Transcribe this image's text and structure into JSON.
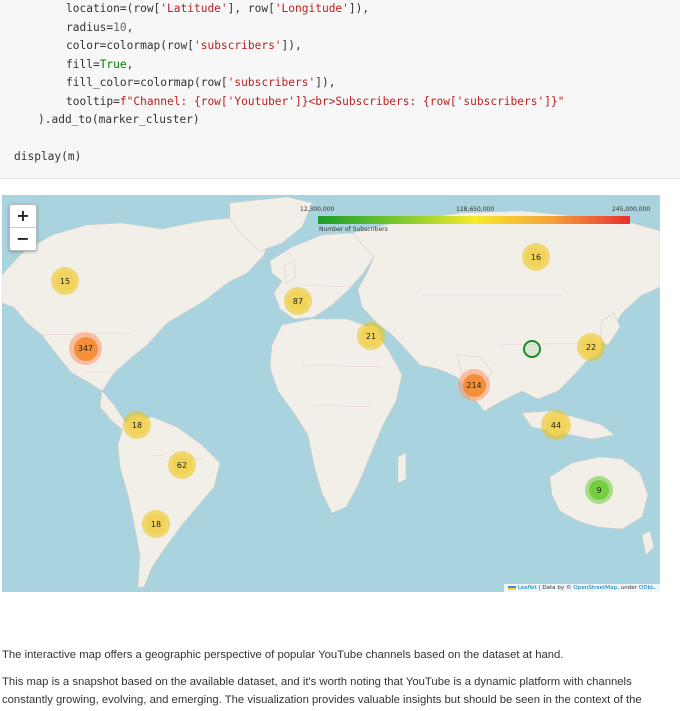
{
  "code": {
    "line1_prefix": "location=(row[",
    "line1_s1": "'Latitude'",
    "line1_mid": "], row[",
    "line1_s2": "'Longitude'",
    "line1_end": "]),",
    "line2_prefix": "radius=",
    "line2_num": "10",
    "line2_end": ",",
    "line3_prefix": "color=colormap(row[",
    "line3_s1": "'subscribers'",
    "line3_end": "]),",
    "line4_prefix": "fill=",
    "line4_kw": "True",
    "line4_end": ",",
    "line5_prefix": "fill_color=colormap(row[",
    "line5_s1": "'subscribers'",
    "line5_end": "]),",
    "line6_prefix": "tooltip=",
    "line6_str": "f\"Channel: {row['Youtuber']}<br>Subscribers: {row['subscribers']}\"",
    "line7": ").add_to(marker_cluster)",
    "line8": "display(m)"
  },
  "map": {
    "zoom_in": "+",
    "zoom_out": "−",
    "legend": {
      "min": "12,300,000",
      "mid": "128,650,000",
      "max": "245,000,000",
      "caption": "Number of Subscribers",
      "colors": [
        "#1a9d2c",
        "#8ccf2f",
        "#f6e92a",
        "#f3a23a",
        "#e83030"
      ]
    },
    "clusters": [
      {
        "label": "15",
        "color": "yellow"
      },
      {
        "label": "347",
        "color": "orange"
      },
      {
        "label": "87",
        "color": "yellow"
      },
      {
        "label": "21",
        "color": "yellow"
      },
      {
        "label": "16",
        "color": "yellow"
      },
      {
        "label": "22",
        "color": "yellow"
      },
      {
        "label": "214",
        "color": "orange"
      },
      {
        "label": "44",
        "color": "yellow"
      },
      {
        "label": "9",
        "color": "green"
      },
      {
        "label": "18",
        "color": "yellow"
      },
      {
        "label": "62",
        "color": "yellow"
      },
      {
        "label": "18",
        "color": "yellow"
      }
    ],
    "attribution": {
      "leaflet": "Leaflet",
      "data_by": "| Data by ©",
      "osm": "OpenStreetMap",
      "under": ", under",
      "odbl": "ODbL."
    }
  },
  "text": {
    "p1": "The interactive map offers a geographic perspective of popular YouTube channels based on the dataset at hand.",
    "p2a": "This map is a snapshot based on the available dataset, and it's worth noting that YouTube is a dynamic platform with channels",
    "p2b": "constantly growing, evolving, and emerging. The visualization provides valuable insights but should be seen in the context of the"
  }
}
